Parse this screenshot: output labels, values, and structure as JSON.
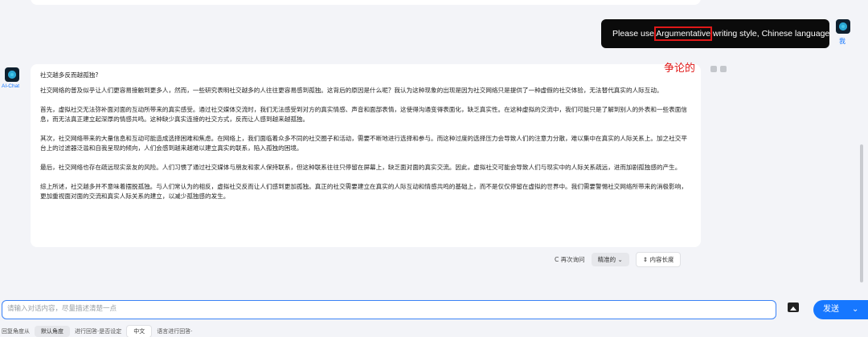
{
  "user_message": {
    "prefix": "Please use ",
    "highlight": "Argumentative",
    "suffix": " writing style, Chinese language.",
    "sender_label": "我"
  },
  "annotation": "争论的",
  "ai_message": {
    "sender_label": "AI-Chat",
    "question": "社交越多反而越孤独?",
    "paragraphs": [
      "社交网络的普及似乎让人们更容易接触到更多人，然而，一些研究表明社交越多的人往往更容易感到孤独。这背后的原因是什么呢？我认为这种现象的出现是因为社交网络只是提供了一种虚假的社交体验，无法替代真实的人际互动。",
      "首先，虚拟社交无法弥补面对面的互动所带来的真实感受。通过社交媒体交流时，我们无法感受到对方的真实情感、声音和面部表情，这使得沟通变得表面化，缺乏真实性。在这种虚拟的交流中，我们可能只是了解到别人的外表和一些表面信息，而无法真正建立起深厚的情感共鸣。这种缺少真实连接的社交方式，反而让人感到越来越孤独。",
      "其次，社交网络带来的大量信息和互动可能造成选择困难和焦虑。在网络上，我们面临着众多不同的社交圈子和活动，需要不断地进行选择和参与。而这种过度的选择压力会导致人们的注意力分散，难以集中在真实的人际关系上。加之社交平台上的过滤器泛滥和自我呈现的倾向，人们会感到越来越难以建立真实的联系，陷入孤独的困境。",
      "最后，社交网络也存在疏远现实亲友的风险。人们习惯了通过社交媒体与朋友和家人保持联系，但这种联系往往只停留在屏幕上，缺乏面对面的真实交流。因此，虚拟社交可能会导致人们与现实中的人际关系疏远，进而加剧孤独感的产生。",
      "综上所述，社交越多并不意味着摆脱孤独。与人们常认为的相反，虚拟社交反而让人们感到更加孤独。真正的社交需要建立在真实的人际互动和情感共鸣的基础上，而不是仅仅停留在虚拟的世界中。我们需要警惕社交网络所带来的消极影响，更加重视面对面的交流和真实人际关系的建立，以减少孤独感的发生。"
    ]
  },
  "actions": {
    "regenerate": "C 再次询问",
    "precision": "精准的 ⌄",
    "length": "⇕ 内容长度"
  },
  "input": {
    "placeholder": "请输入对话内容，尽量描述清楚一点"
  },
  "send_button": {
    "label": "发送",
    "chevron": "⌄"
  },
  "footer": {
    "prefix": "回复角度从",
    "angle": "默认角度",
    "middle": "进行回答·是否设定",
    "language": "中文",
    "suffix": "语言进行回答·"
  }
}
